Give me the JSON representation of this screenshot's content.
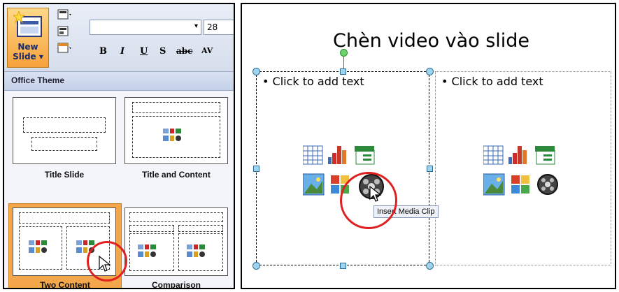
{
  "ribbon": {
    "new_slide_label_1": "New",
    "new_slide_label_2": "Slide",
    "font_size": "28",
    "format_bold": "B",
    "format_italic": "I",
    "format_underline": "U",
    "format_shadow": "S",
    "format_strike": "abc",
    "format_spacing": "AV"
  },
  "gallery": {
    "header": "Office Theme",
    "layouts": [
      {
        "label": "Title Slide"
      },
      {
        "label": "Title and Content"
      },
      {
        "label": "Two Content"
      },
      {
        "label": "Comparison"
      }
    ]
  },
  "slide": {
    "title": "Chèn video vào slide",
    "left_placeholder_text": "Click to add text",
    "right_placeholder_text": "Click to add text",
    "bullet": "•"
  },
  "tooltip": "Insert Media Clip",
  "colors": {
    "accent_orange": "#f4a64a",
    "highlight_red": "#e02020"
  }
}
